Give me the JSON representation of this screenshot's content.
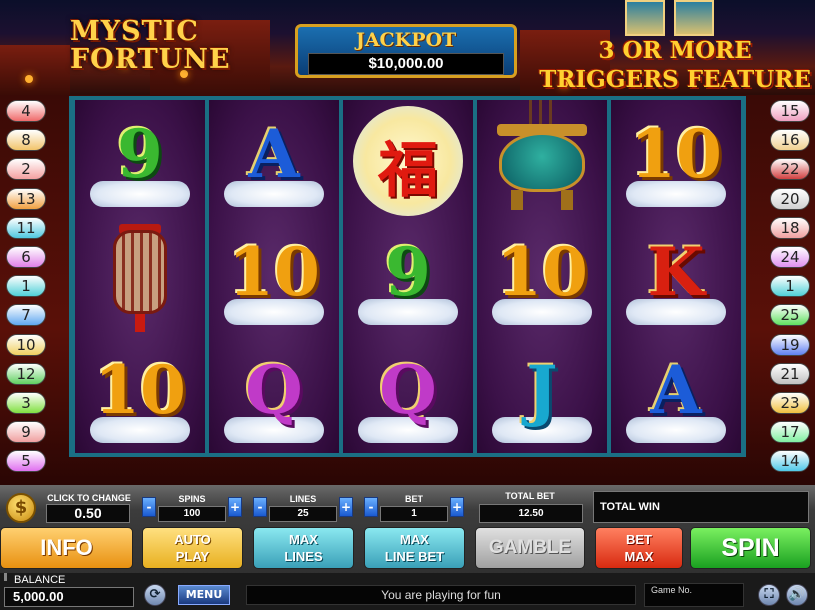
{
  "header": {
    "logo_line1": "MYSTIC",
    "logo_line2": "FORTUNE",
    "jackpot_label": "JACKPOT",
    "jackpot_value": "$10,000.00",
    "feature_line1": "3 OR MORE",
    "feature_line2": "TRIGGERS FEATURE"
  },
  "reels": [
    [
      {
        "kind": "letter",
        "text": "9",
        "color": "green"
      },
      {
        "kind": "lantern",
        "icon": "lantern-icon"
      },
      {
        "kind": "letter",
        "text": "10",
        "color": "gold"
      }
    ],
    [
      {
        "kind": "letter",
        "text": "A",
        "color": "blue"
      },
      {
        "kind": "letter",
        "text": "10",
        "color": "gold"
      },
      {
        "kind": "letter",
        "text": "Q",
        "color": "pink"
      }
    ],
    [
      {
        "kind": "fortune",
        "text": "福",
        "icon": "fortune-symbol-icon"
      },
      {
        "kind": "letter",
        "text": "9",
        "color": "green"
      },
      {
        "kind": "letter",
        "text": "Q",
        "color": "pink"
      }
    ],
    [
      {
        "kind": "urn",
        "icon": "incense-urn-icon"
      },
      {
        "kind": "letter",
        "text": "10",
        "color": "gold"
      },
      {
        "kind": "letter",
        "text": "J",
        "color": "cyan"
      }
    ],
    [
      {
        "kind": "letter",
        "text": "10",
        "color": "gold"
      },
      {
        "kind": "letter",
        "text": "K",
        "color": "red"
      },
      {
        "kind": "letter",
        "text": "A",
        "color": "blue"
      }
    ]
  ],
  "paylines_left": [
    {
      "n": "4",
      "color": "#f06a6a"
    },
    {
      "n": "8",
      "color": "#f2c46a"
    },
    {
      "n": "2",
      "color": "#f4a0a0"
    },
    {
      "n": "13",
      "color": "#f0a040"
    },
    {
      "n": "11",
      "color": "#50c8e0"
    },
    {
      "n": "6",
      "color": "#e080e8"
    },
    {
      "n": "1",
      "color": "#50d0d8"
    },
    {
      "n": "7",
      "color": "#60a8f0"
    },
    {
      "n": "10",
      "color": "#f0d060"
    },
    {
      "n": "12",
      "color": "#60d060"
    },
    {
      "n": "3",
      "color": "#80e040"
    },
    {
      "n": "9",
      "color": "#f0a0a0"
    },
    {
      "n": "5",
      "color": "#e070f0"
    }
  ],
  "paylines_right": [
    {
      "n": "15",
      "color": "#f0a0c0"
    },
    {
      "n": "16",
      "color": "#f0d090"
    },
    {
      "n": "22",
      "color": "#d04040"
    },
    {
      "n": "20",
      "color": "#d0d0d0"
    },
    {
      "n": "18",
      "color": "#f0a0a0"
    },
    {
      "n": "24",
      "color": "#e090f0"
    },
    {
      "n": "1",
      "color": "#50d0d8"
    },
    {
      "n": "25",
      "color": "#60e060"
    },
    {
      "n": "19",
      "color": "#6080f0"
    },
    {
      "n": "21",
      "color": "#c0c0c0"
    },
    {
      "n": "23",
      "color": "#f0c040"
    },
    {
      "n": "17",
      "color": "#80f0a0"
    },
    {
      "n": "14",
      "color": "#50c8e8"
    }
  ],
  "controls": {
    "coin_icon": "dollar-coin-icon",
    "coin_symbol": "$",
    "click_to_change_label": "CLICK TO CHANGE",
    "coin_value": "0.50",
    "spins_label": "SPINS",
    "spins_value": "100",
    "lines_label": "LINES",
    "lines_value": "25",
    "bet_label": "BET",
    "bet_value": "1",
    "minus": "-",
    "plus": "+",
    "total_bet_label": "TOTAL BET",
    "total_bet_value": "12.50",
    "total_win_label": "TOTAL WIN",
    "total_win_value": "",
    "info_label": "INFO",
    "auto_play_line1": "AUTO",
    "auto_play_line2": "PLAY",
    "max_lines_line1": "MAX",
    "max_lines_line2": "LINES",
    "max_line_bet_line1": "MAX",
    "max_line_bet_line2": "LINE BET",
    "gamble_label": "GAMBLE",
    "bet_max_line1": "BET",
    "bet_max_line2": "MAX",
    "spin_label": "SPIN"
  },
  "status": {
    "balance_label": "BALANCE",
    "balance_value": "5,000.00",
    "menu_label": "MENU",
    "message": "You are playing for fun",
    "game_no_label": "Game No.",
    "refresh_icon": "refresh-icon",
    "fullscreen_icon": "fullscreen-icon",
    "sound_icon": "speaker-icon"
  }
}
